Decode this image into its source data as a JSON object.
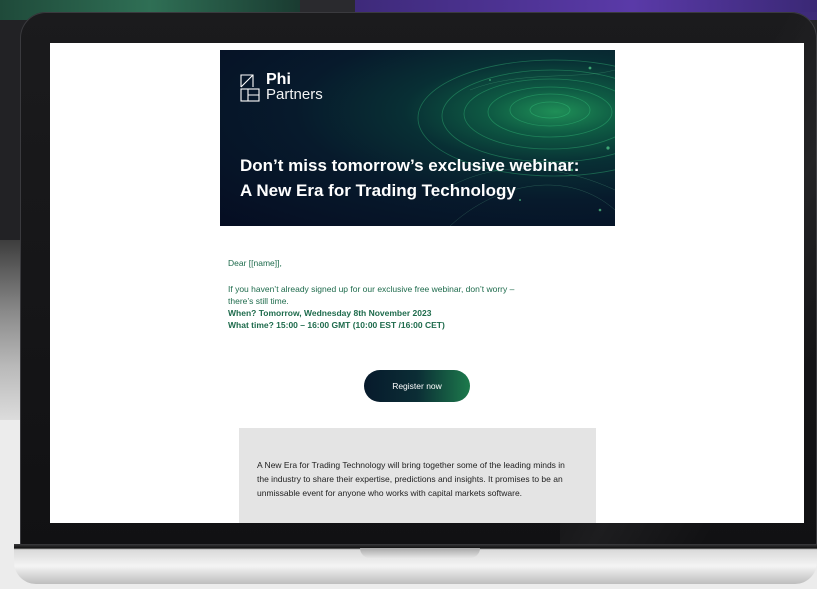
{
  "email": {
    "logo": {
      "line1": "Phi",
      "line2": "Partners"
    },
    "hero_title_line1": "Don’t miss tomorrow’s exclusive webinar:",
    "hero_title_line2": "A New Era for Trading Technology",
    "greeting": "Dear [[name]],",
    "intro_line1": "If you haven’t already signed up for our exclusive free webinar, don’t worry –",
    "intro_line2": "there’s still time.",
    "when": "When? Tomorrow, Wednesday 8th November 2023",
    "time": "What time? 15:00 – 16:00 GMT (10:00 EST /16:00 CET)",
    "register_label": "Register now",
    "info_text": "A New Era for Trading Technology will bring together some of the leading minds in the industry to share their expertise, predictions and insights. It promises to be an unmissable event for anyone who works with capital markets software."
  },
  "colors": {
    "accent_green": "#1e6b4c",
    "hero_dark": "#071a2c",
    "button_gradient_end": "#1d7a4c"
  }
}
